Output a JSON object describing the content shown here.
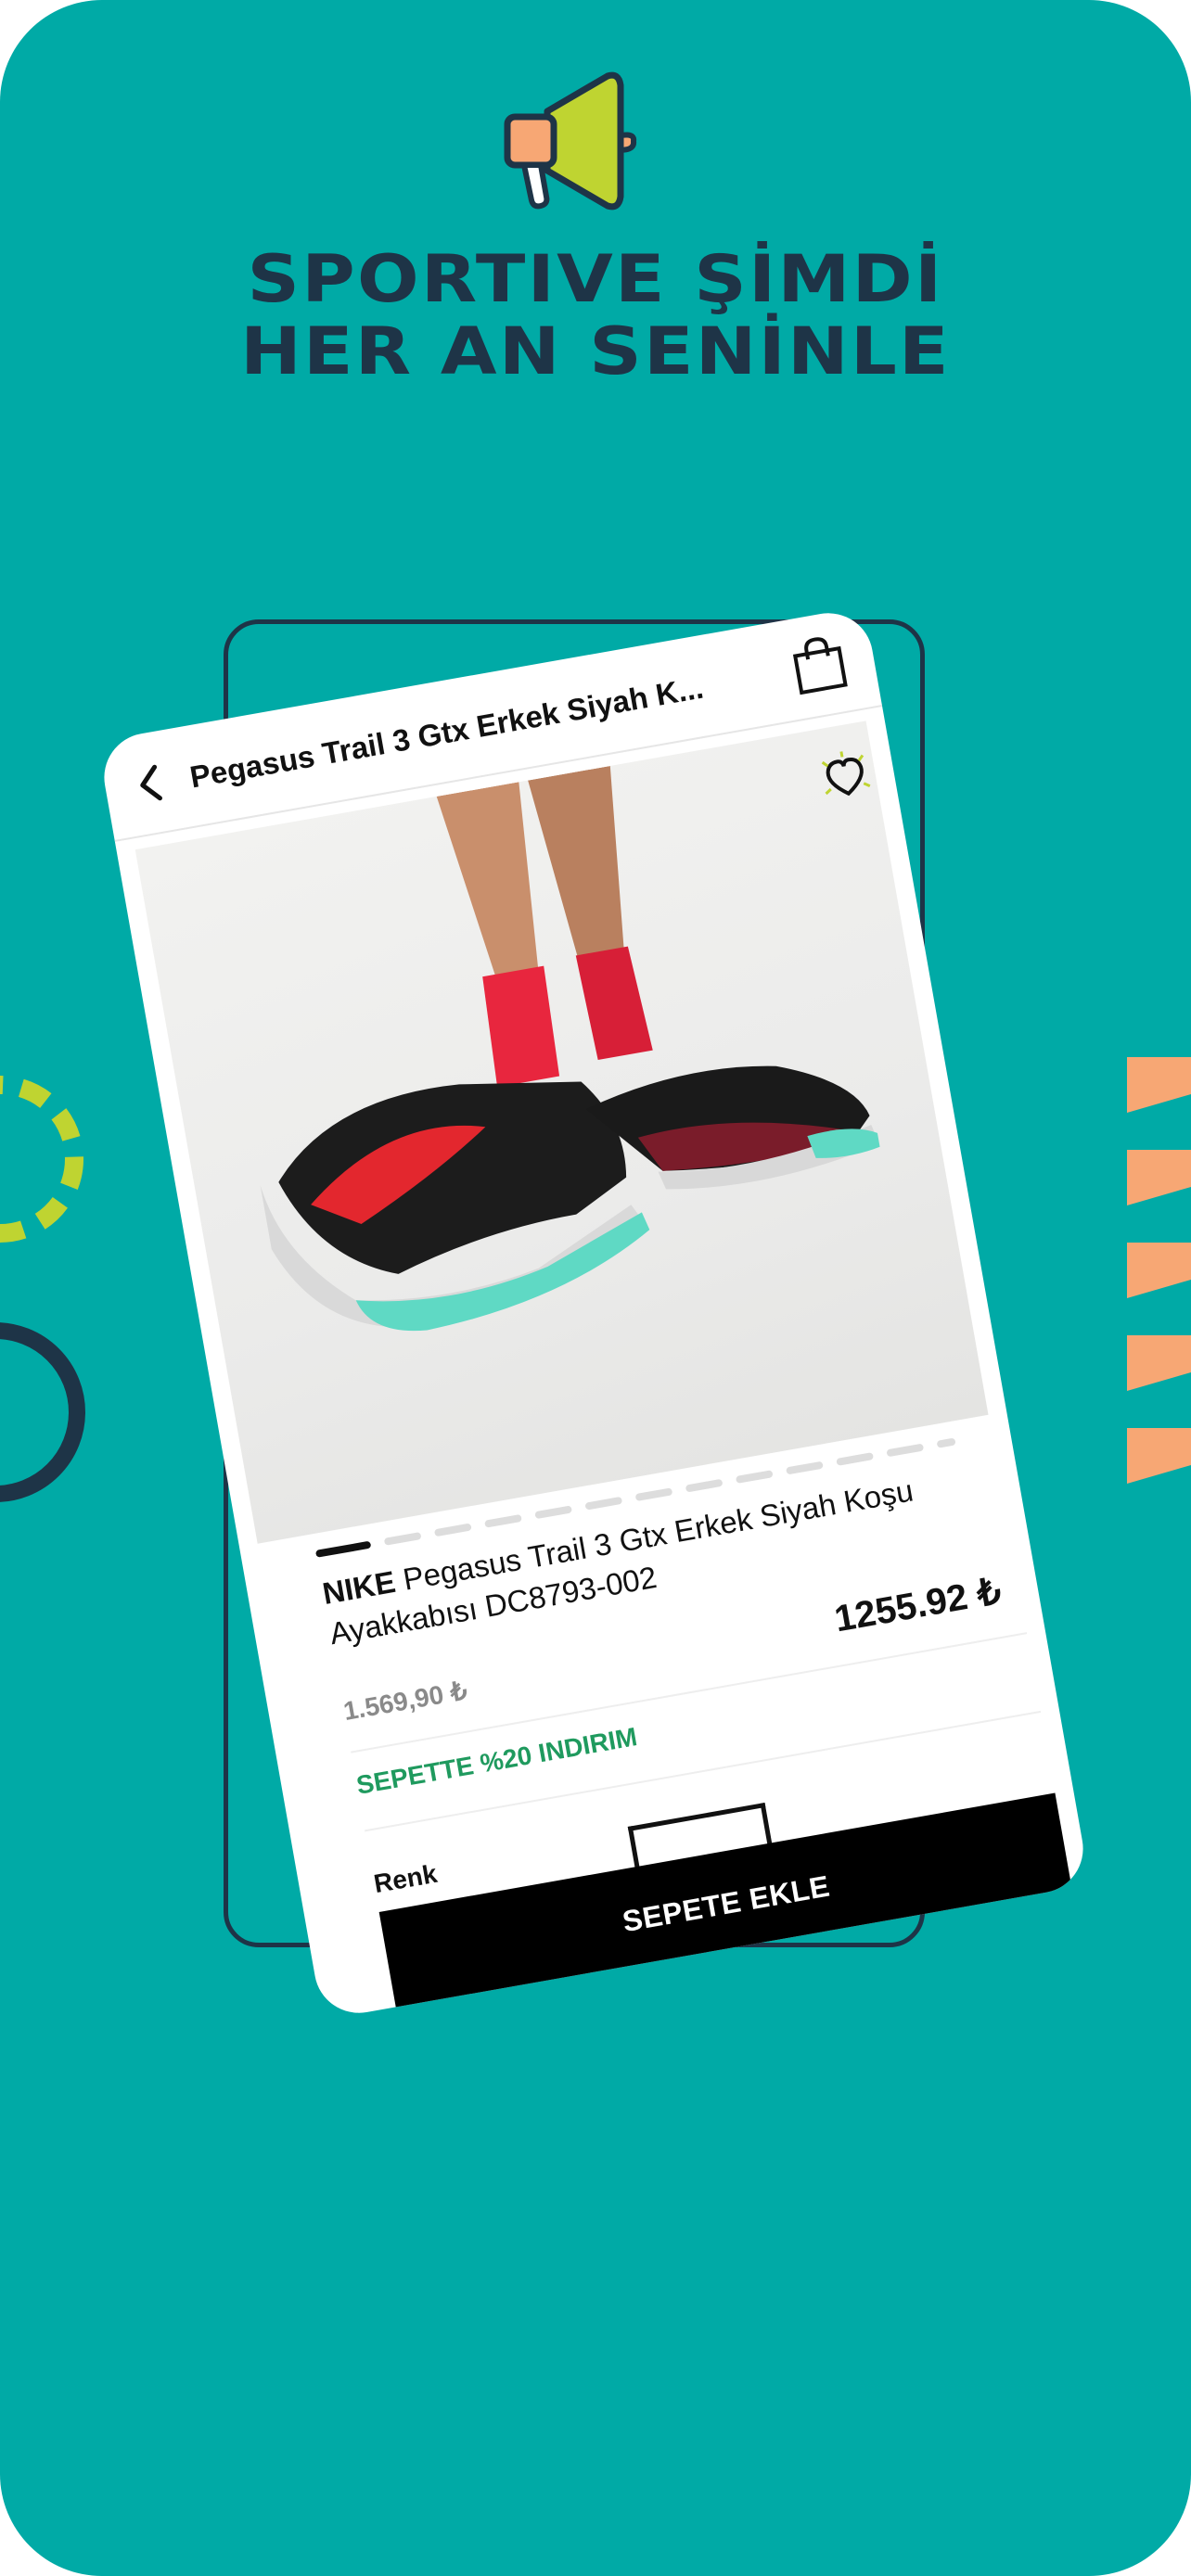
{
  "headline": {
    "line1": "SPORTIVE ŞİMDİ",
    "line2": "HER AN SENİNLE"
  },
  "product_screen": {
    "nav_title": "Pegasus Trail 3 Gtx Erkek Siyah K...",
    "icons": {
      "back": "chevron-left-icon",
      "bag": "shopping-bag-icon",
      "favorite": "heart-icon"
    },
    "brand": "NIKE",
    "product_name": "Pegasus Trail 3 Gtx Erkek Siyah Koşu Ayakkabısı DC8793-002",
    "old_price": "1.569,90 ₺",
    "new_price": "1255.92 ₺",
    "promo_text": "SEPETTE %20 INDIRIM",
    "color_label": "Renk",
    "add_to_cart_label": "SEPETE EKLE",
    "image_pager": {
      "total": 13,
      "active_index": 0
    }
  },
  "colors": {
    "background": "#00AAA6",
    "headline": "#1E3447",
    "promo": "#1F9A5E",
    "accent_orange": "#F7A774",
    "accent_lime": "#BFD431"
  }
}
